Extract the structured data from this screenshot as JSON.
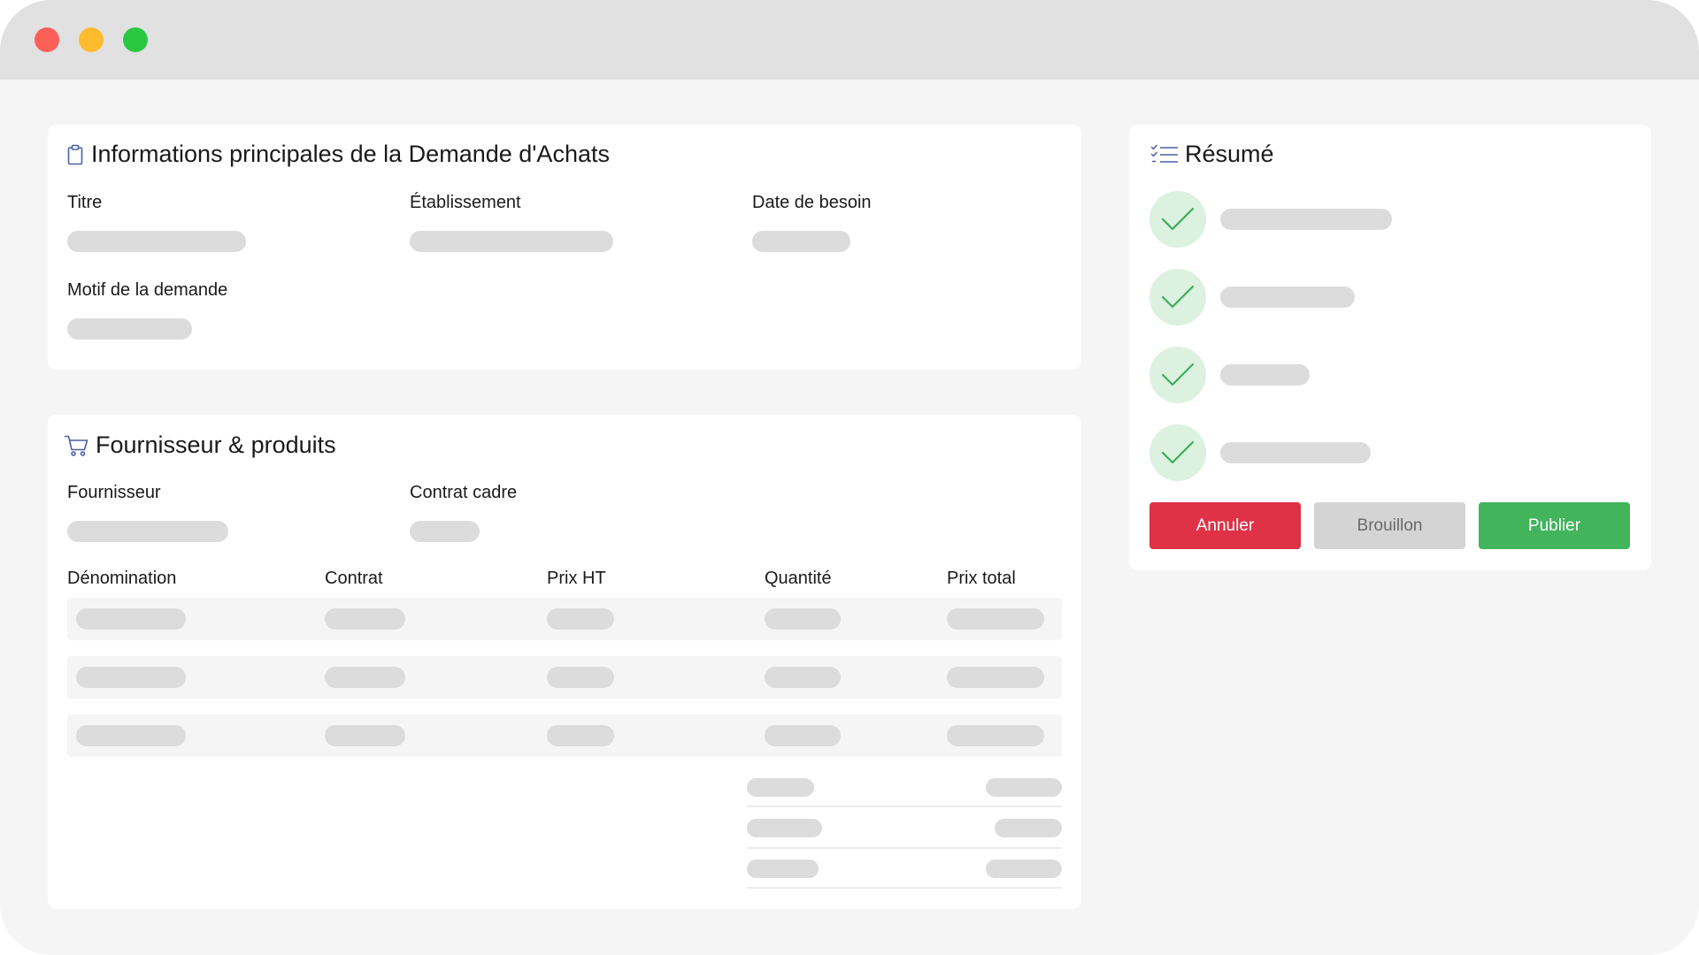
{
  "window": {
    "controls": [
      "close",
      "minimize",
      "maximize"
    ]
  },
  "main_info": {
    "title": "Informations principales de la Demande d'Achats",
    "icon": "clipboard-icon",
    "fields": {
      "titre": "Titre",
      "etablissement": "Établissement",
      "date_besoin": "Date de besoin",
      "motif": "Motif de la demande"
    }
  },
  "supplier": {
    "title": "Fournisseur & produits",
    "icon": "cart-icon",
    "fields": {
      "fournisseur": "Fournisseur",
      "contrat_cadre": "Contrat cadre"
    },
    "table": {
      "columns": [
        "Dénomination",
        "Contrat",
        "Prix HT",
        "Quantité",
        "Prix total"
      ],
      "row_count": 3
    },
    "totals_count": 3
  },
  "summary": {
    "title": "Résumé",
    "icon": "checklist-icon",
    "items_completed": 4
  },
  "actions": {
    "cancel": "Annuler",
    "draft": "Brouillon",
    "publish": "Publier"
  },
  "colors": {
    "cancel": "#df3246",
    "draft": "#d4d4d4",
    "publish": "#41b45c",
    "check_bg": "#dcf1e0",
    "check_stroke": "#3cae5a",
    "skeleton": "#dcdcdc"
  }
}
